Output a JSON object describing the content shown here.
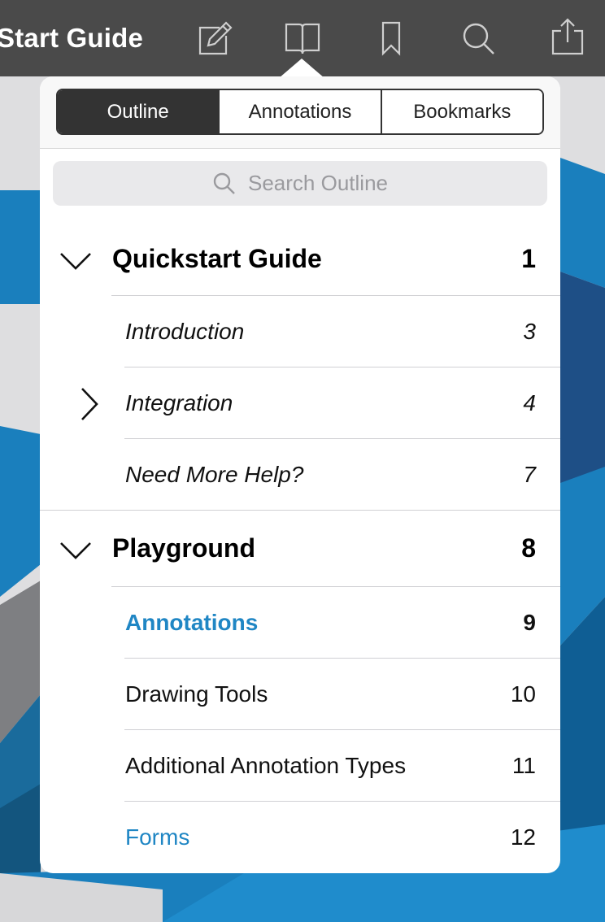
{
  "toolbar": {
    "title": "Start Guide",
    "icons": [
      "edit-icon",
      "outline-book-icon",
      "bookmark-icon",
      "search-icon",
      "share-icon"
    ]
  },
  "tabs": [
    {
      "label": "Outline",
      "active": true
    },
    {
      "label": "Annotations",
      "active": false
    },
    {
      "label": "Bookmarks",
      "active": false
    }
  ],
  "search": {
    "placeholder": "Search Outline"
  },
  "outline": [
    {
      "label": "Quickstart Guide",
      "page": "1",
      "level": 0,
      "expanded": true
    },
    {
      "label": "Introduction",
      "page": "3",
      "level": 1
    },
    {
      "label": "Integration",
      "page": "4",
      "level": 1,
      "collapsed_children": true
    },
    {
      "label": "Need More Help?",
      "page": "7",
      "level": 1
    },
    {
      "label": "Playground",
      "page": "8",
      "level": 0,
      "expanded": true
    },
    {
      "label": "Annotations",
      "page": "9",
      "level": 1,
      "current": true
    },
    {
      "label": "Drawing Tools",
      "page": "10",
      "level": 1
    },
    {
      "label": "Additional Annotation Types",
      "page": "11",
      "level": 1
    },
    {
      "label": "Forms",
      "page": "12",
      "level": 1,
      "link": true
    }
  ],
  "colors": {
    "toolbar": "#4a4a4a",
    "accent": "#1f86c4",
    "background_blue": "#1a7fbd"
  }
}
